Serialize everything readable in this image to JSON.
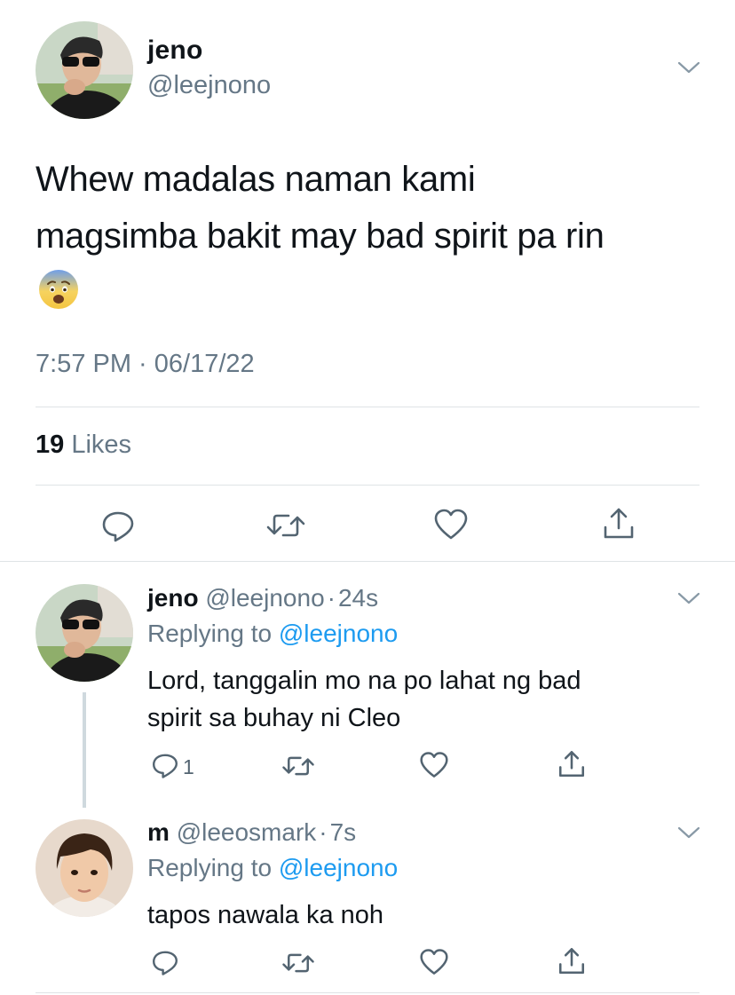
{
  "main_tweet": {
    "name": "jeno",
    "handle": "@leejnono",
    "text_line1": "Whew madalas naman kami",
    "text_line2": "magsimba bakit may bad spirit pa rin",
    "emoji": "😨",
    "timestamp": "7:57 PM · 06/17/22",
    "likes_count": "19",
    "likes_label": "Likes"
  },
  "replies": [
    {
      "name": "jeno",
      "handle": "@leejnono",
      "sep": "·",
      "time": "24s",
      "replying_prefix": "Replying to",
      "replying_handle": "@leejnono",
      "text_line1": "Lord, tanggalin mo na po lahat ng bad",
      "text_line2": "spirit sa buhay ni Cleo",
      "reply_count": "1"
    },
    {
      "name": "m",
      "handle": "@leeosmark",
      "sep": "·",
      "time": "7s",
      "replying_prefix": "Replying to",
      "replying_handle": "@leejnono",
      "text_line1": "tapos nawala ka noh"
    }
  ],
  "colors": {
    "text": "#0f1419",
    "secondary": "#657786",
    "link": "#1d9bf0",
    "divider": "#dfe3e6",
    "action_icon": "#536471"
  },
  "icons": {
    "more": "chevron-down-icon",
    "reply": "reply-icon",
    "retweet": "retweet-icon",
    "like": "heart-icon",
    "share": "share-icon"
  }
}
